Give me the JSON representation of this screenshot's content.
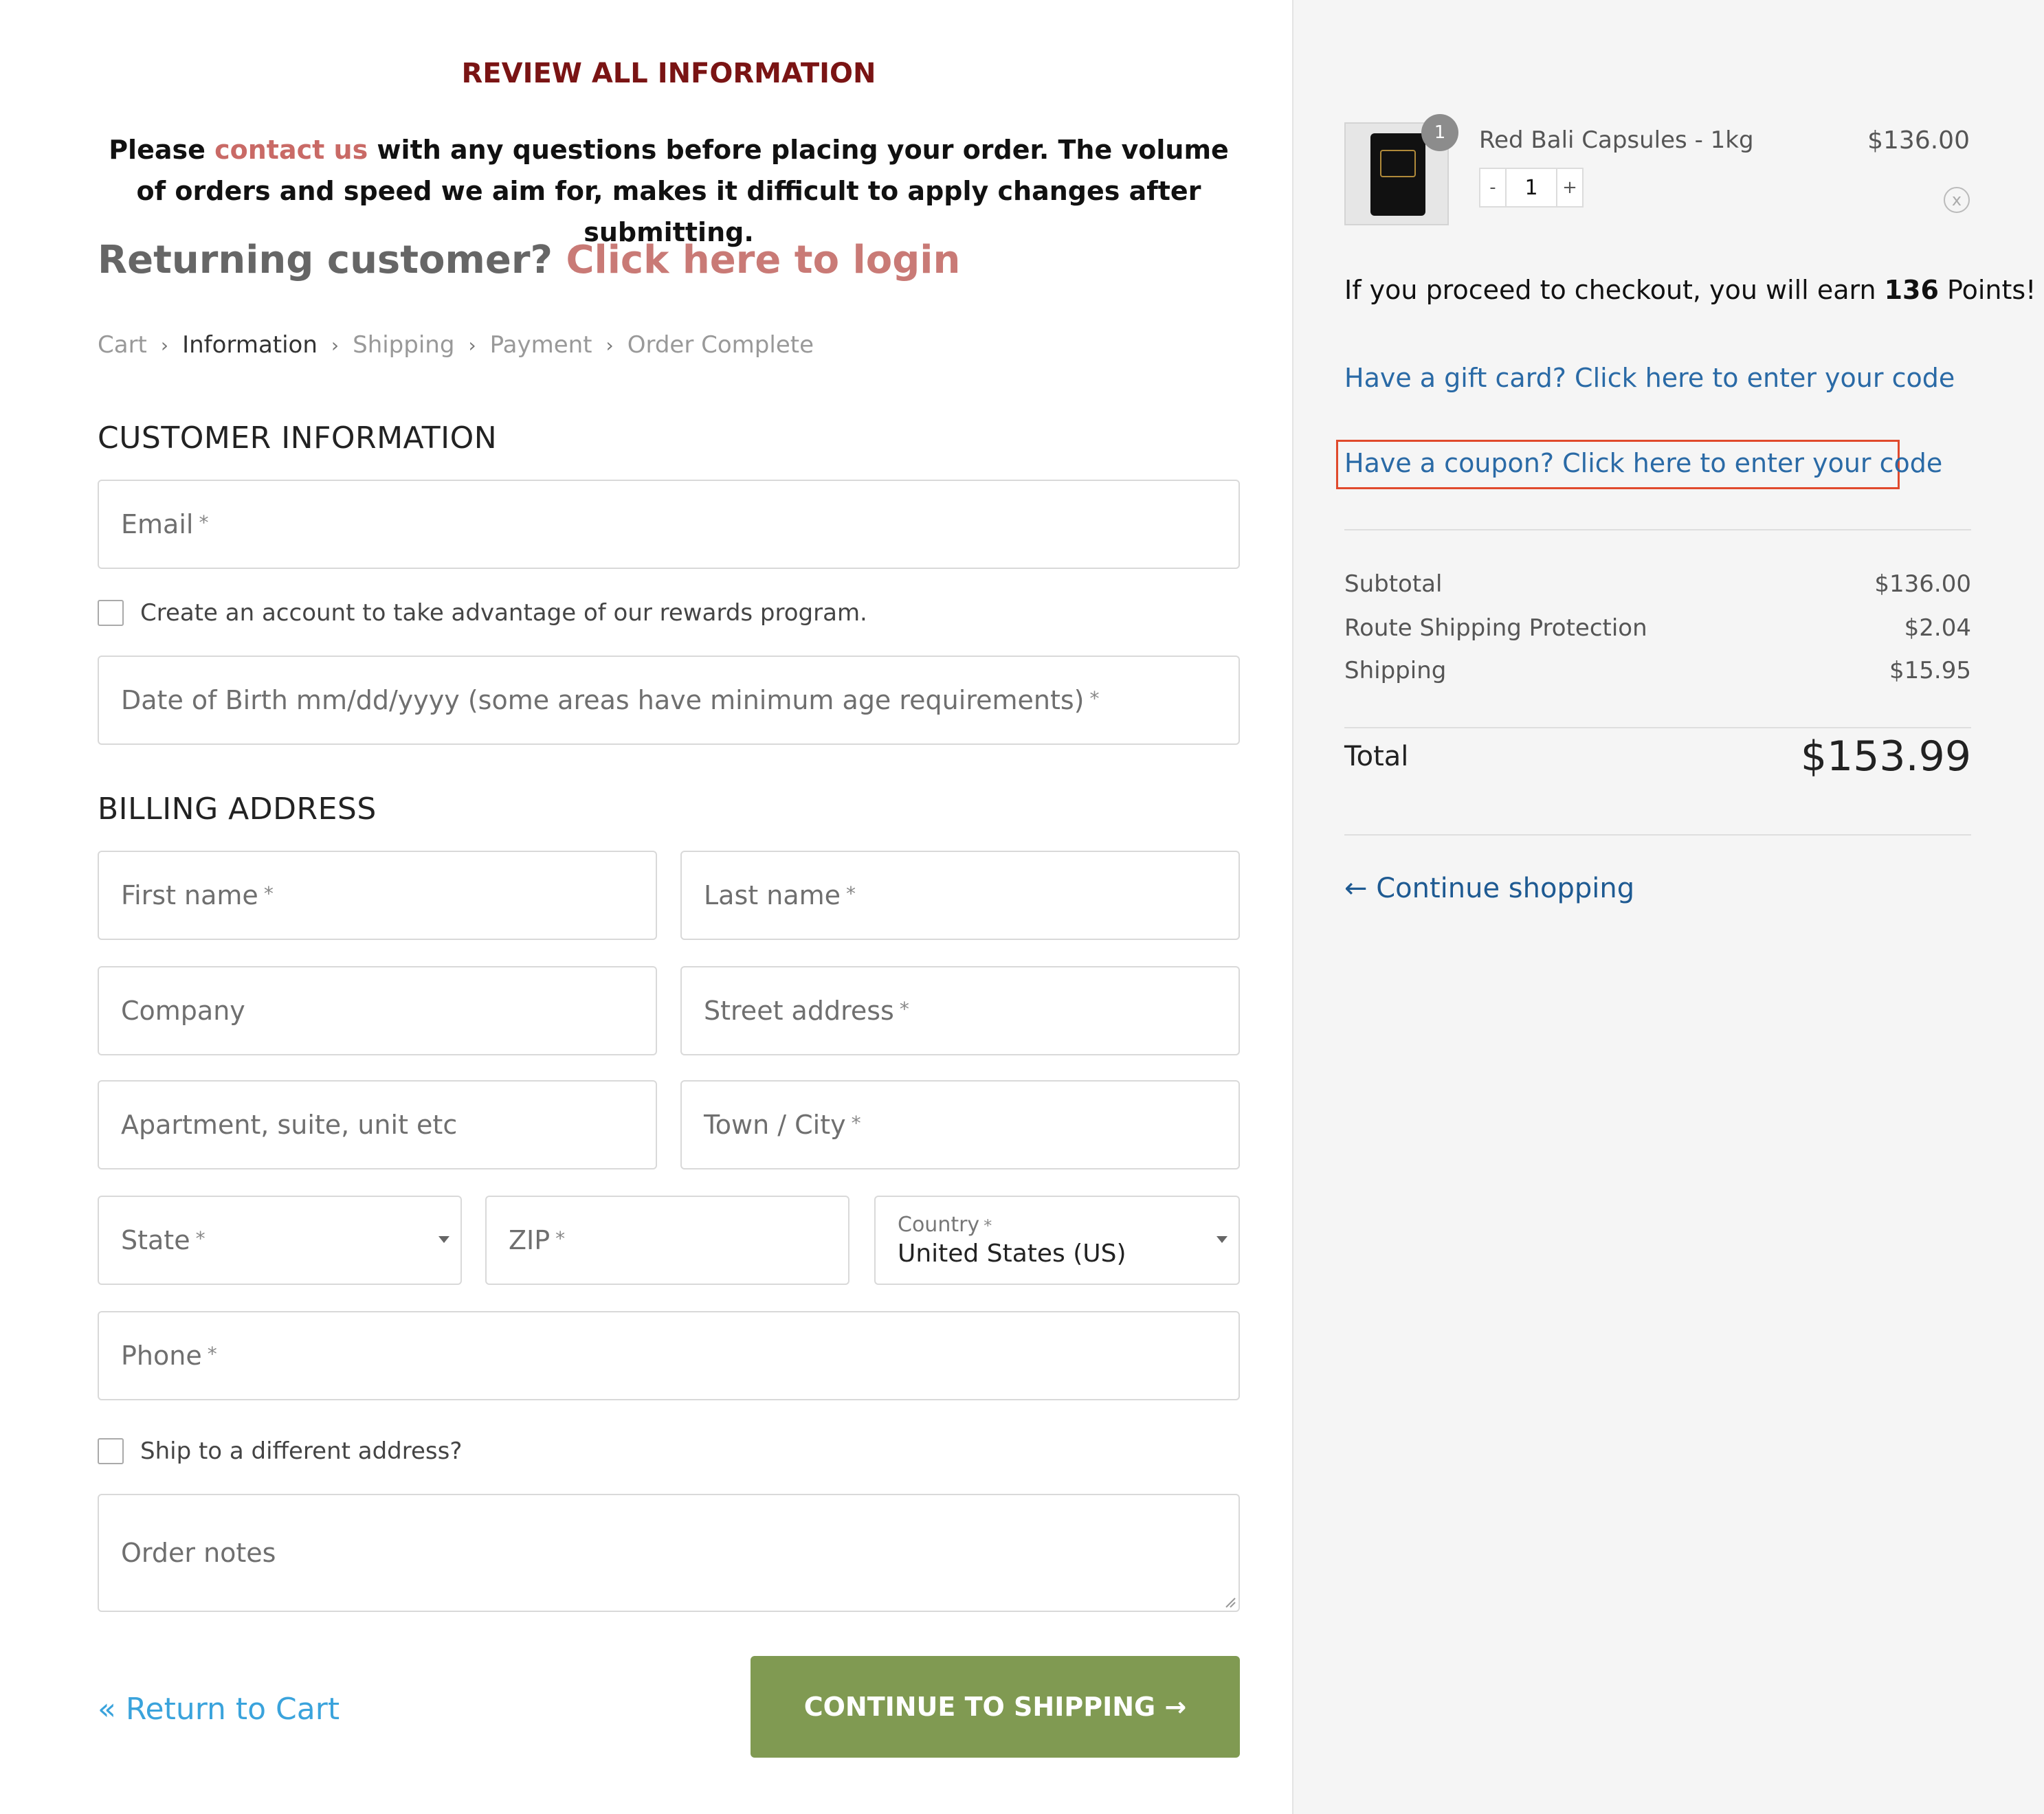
{
  "notice": {
    "title": "REVIEW ALL INFORMATION",
    "text_before": "Please ",
    "contact_link": "contact us",
    "text_after": " with any questions before placing your order. The volume of orders and speed we aim for, makes it difficult to apply changes after submitting."
  },
  "returning": {
    "prompt": "Returning customer?",
    "login_link": "Click here to login"
  },
  "breadcrumb": {
    "items": [
      "Cart",
      "Information",
      "Shipping",
      "Payment",
      "Order Complete"
    ],
    "active": "Information"
  },
  "customer_info": {
    "title": "CUSTOMER INFORMATION",
    "email_placeholder": "Email",
    "create_account_label": "Create an account to take advantage of our rewards program.",
    "dob_placeholder": "Date of Birth mm/dd/yyyy (some areas have minimum age requirements)"
  },
  "billing": {
    "title": "BILLING ADDRESS",
    "first_name": "First name",
    "last_name": "Last name",
    "company": "Company",
    "street": "Street address",
    "apartment": "Apartment, suite, unit etc",
    "city": "Town / City",
    "state": "State",
    "zip": "ZIP",
    "country_label": "Country",
    "country_value": "United States (US)",
    "phone": "Phone",
    "ship_different_label": "Ship to a different address?",
    "order_notes": "Order notes"
  },
  "required_mark": "*",
  "actions": {
    "return_to_cart": "« Return to Cart",
    "continue_to_shipping": "CONTINUE TO SHIPPING →"
  },
  "order_summary": {
    "item": {
      "name": "Red Bali Capsules - 1kg",
      "price": "$136.00",
      "quantity_badge": "1",
      "quantity": "1",
      "minus": "-",
      "plus": "+",
      "remove": "x"
    },
    "points_before": "If you proceed to checkout, you will earn ",
    "points_value": "136",
    "points_after": " Points!",
    "gift_card_link": "Have a gift card? Click here to enter your code",
    "coupon_link": "Have a coupon? Click here to enter your code",
    "subtotal_label": "Subtotal",
    "subtotal_value": "$136.00",
    "route_label": "Route Shipping Protection",
    "route_value": "$2.04",
    "shipping_label": "Shipping",
    "shipping_value": "$15.95",
    "total_label": "Total",
    "total_value": "$153.99",
    "continue_shopping": "← Continue shopping"
  },
  "colors": {
    "notice_title": "#7a1414",
    "link_red": "#c96a66",
    "link_blue": "#2a6aa6",
    "button_green": "#809a52",
    "highlight_box": "#e04a2c"
  }
}
